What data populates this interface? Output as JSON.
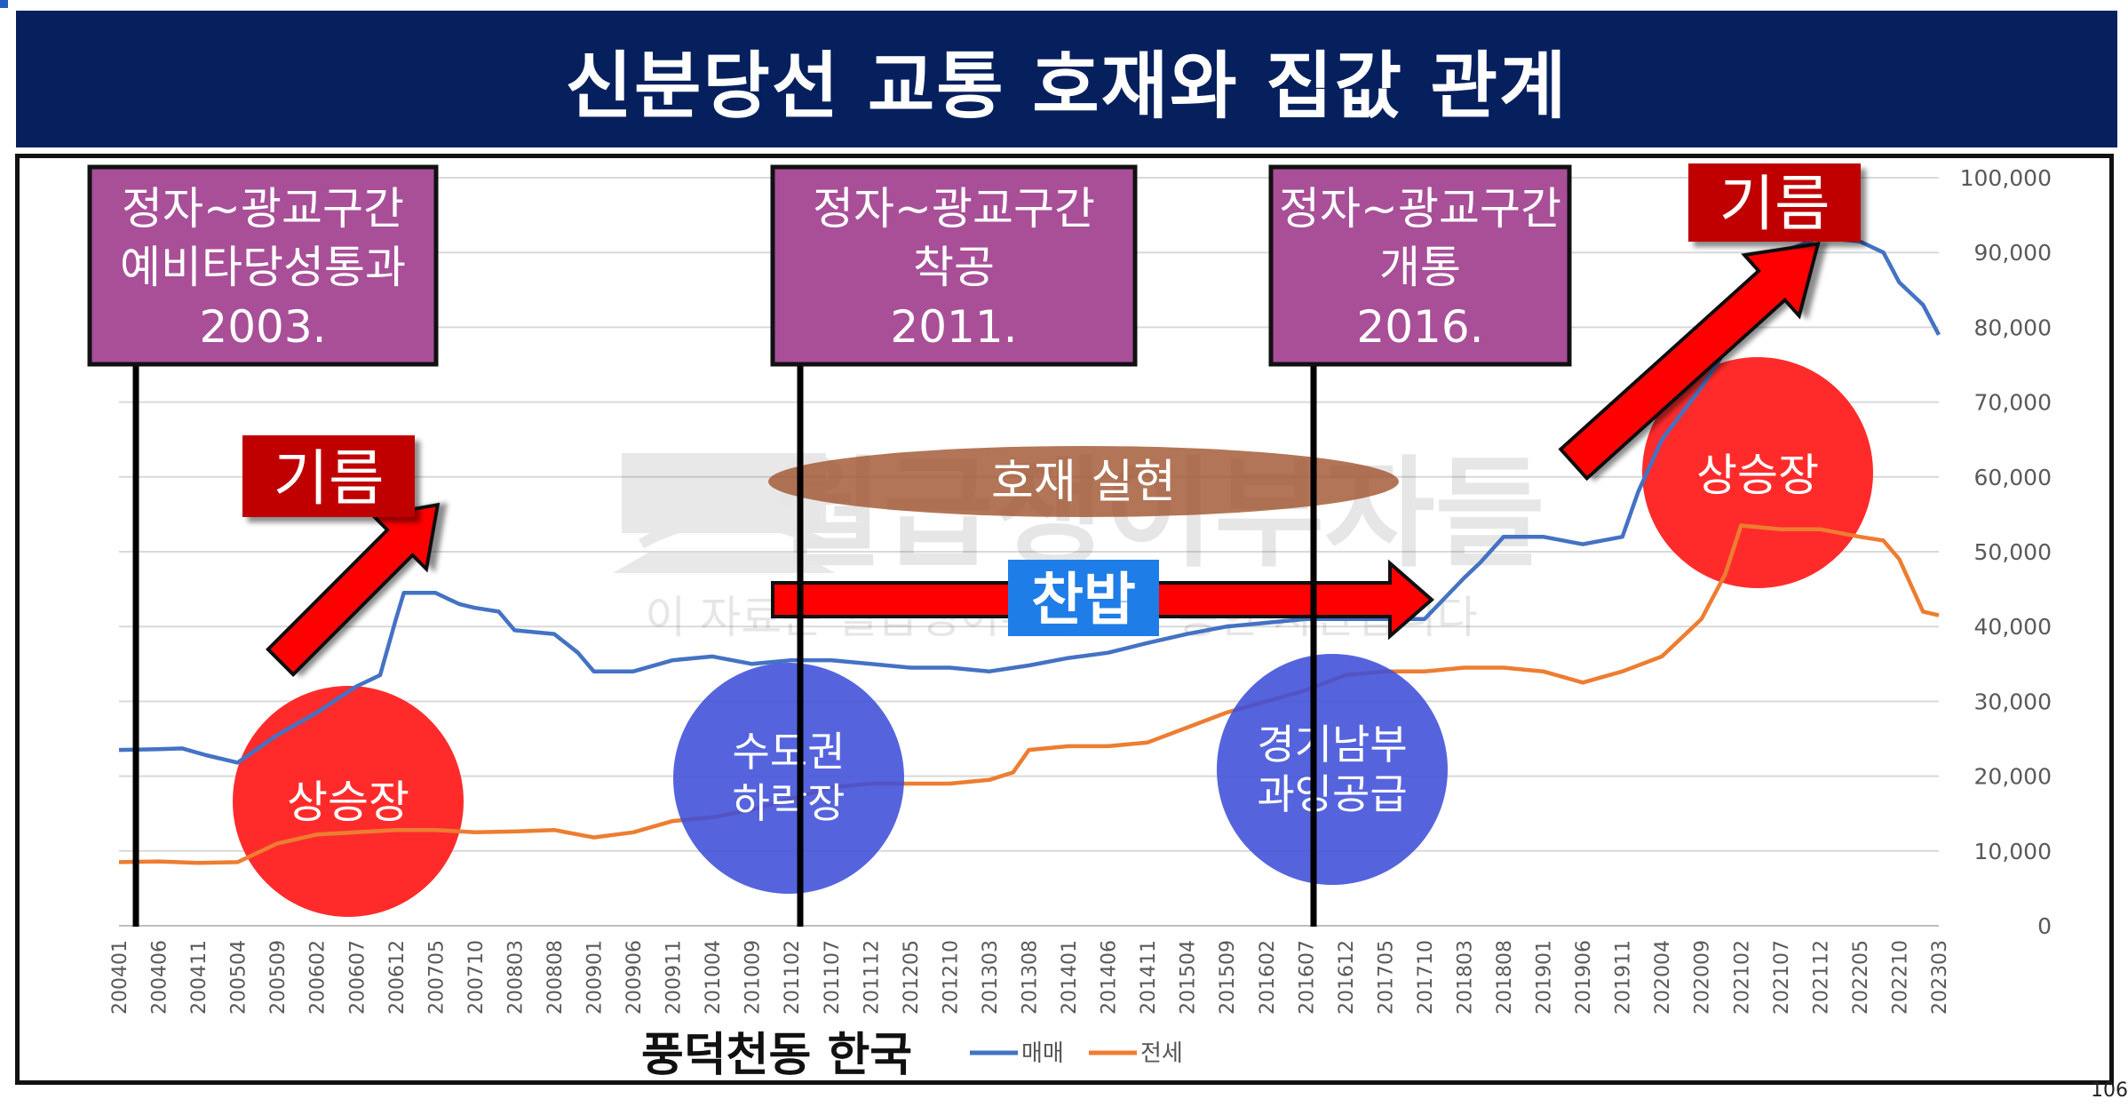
{
  "page": {
    "title": "신분당선 교통 호재와 집값 관계",
    "page_number": "106"
  },
  "watermark": {
    "line1": "월급쟁이부자들",
    "line2": "이 자료는 월급쟁이부자들을 통한 자산입니다"
  },
  "annotations": {
    "events": [
      {
        "line1": "정자~광교구간",
        "line2": "예비타당성통과",
        "line3": "2003."
      },
      {
        "line1": "정자~광교구간",
        "line2": "착공",
        "line3": "2011."
      },
      {
        "line1": "정자~광교구간",
        "line2": "개통",
        "line3": "2016."
      }
    ],
    "momentum_left": "기름",
    "momentum_right": "기름",
    "realization": "호재 실현",
    "cold_rice": "찬밥",
    "circles": [
      {
        "line1": "상승장",
        "line2": "",
        "color": "#ff2b2b"
      },
      {
        "line1": "수도권",
        "line2": "하락장",
        "color": "#3e4fd8"
      },
      {
        "line1": "경기남부",
        "line2": "과잉공급",
        "color": "#3e4fd8"
      },
      {
        "line1": "상승장",
        "line2": "",
        "color": "#ff2b2b"
      }
    ],
    "location": "풍덕천동 한국"
  },
  "chart_data": {
    "type": "line",
    "title": "신분당선 교통 호재와 집값 관계",
    "xlabel": "",
    "ylabel": "",
    "ylim": [
      0,
      100000
    ],
    "yticks": [
      "0",
      "10,000",
      "20,000",
      "30,000",
      "40,000",
      "50,000",
      "60,000",
      "70,000",
      "80,000",
      "90,000",
      "100,000"
    ],
    "xtick_labels": [
      "200401",
      "200406",
      "200411",
      "200504",
      "200509",
      "200602",
      "200607",
      "200612",
      "200705",
      "200710",
      "200803",
      "200808",
      "200901",
      "200906",
      "200911",
      "201004",
      "201009",
      "201102",
      "201107",
      "201112",
      "201205",
      "201210",
      "201303",
      "201308",
      "201401",
      "201406",
      "201411",
      "201504",
      "201509",
      "201602",
      "201607",
      "201612",
      "201705",
      "201710",
      "201803",
      "201808",
      "201901",
      "201906",
      "201911",
      "202004",
      "202009",
      "202102",
      "202107",
      "202112",
      "202205",
      "202210",
      "202303"
    ],
    "grid": true,
    "legend_position": "bottom",
    "colors": {
      "sale": "#4472c4",
      "jeonse": "#ed7d31"
    },
    "series": [
      {
        "name": "매매",
        "points": [
          [
            "200401",
            23500
          ],
          [
            "200406",
            23600
          ],
          [
            "200409",
            23700
          ],
          [
            "200412",
            22800
          ],
          [
            "200504",
            21800
          ],
          [
            "200509",
            25500
          ],
          [
            "200602",
            28500
          ],
          [
            "200607",
            32000
          ],
          [
            "200610",
            33500
          ],
          [
            "200612",
            41000
          ],
          [
            "200701",
            44500
          ],
          [
            "200705",
            44500
          ],
          [
            "200708",
            43000
          ],
          [
            "200710",
            42500
          ],
          [
            "200801",
            42000
          ],
          [
            "200803",
            39500
          ],
          [
            "200808",
            39000
          ],
          [
            "200811",
            36500
          ],
          [
            "200901",
            34000
          ],
          [
            "200906",
            34000
          ],
          [
            "200911",
            35500
          ],
          [
            "201004",
            36000
          ],
          [
            "201009",
            35000
          ],
          [
            "201102",
            35500
          ],
          [
            "201107",
            35500
          ],
          [
            "201112",
            35000
          ],
          [
            "201205",
            34500
          ],
          [
            "201210",
            34500
          ],
          [
            "201303",
            34000
          ],
          [
            "201308",
            34800
          ],
          [
            "201401",
            35800
          ],
          [
            "201406",
            36500
          ],
          [
            "201411",
            37800
          ],
          [
            "201504",
            39000
          ],
          [
            "201509",
            40000
          ],
          [
            "201602",
            40500
          ],
          [
            "201607",
            41000
          ],
          [
            "201612",
            41000
          ],
          [
            "201705",
            41000
          ],
          [
            "201710",
            41000
          ],
          [
            "201803",
            46500
          ],
          [
            "201805",
            48500
          ],
          [
            "201808",
            52000
          ],
          [
            "201901",
            52000
          ],
          [
            "201906",
            51000
          ],
          [
            "201911",
            52000
          ],
          [
            "202001",
            58000
          ],
          [
            "202004",
            65000
          ],
          [
            "202009",
            72000
          ],
          [
            "202102",
            80000
          ],
          [
            "202104",
            87000
          ],
          [
            "202107",
            90000
          ],
          [
            "202112",
            92000
          ],
          [
            "202205",
            91500
          ],
          [
            "202208",
            90000
          ],
          [
            "202210",
            86000
          ],
          [
            "202301",
            83000
          ],
          [
            "202303",
            79000
          ]
        ]
      },
      {
        "name": "전세",
        "points": [
          [
            "200401",
            8500
          ],
          [
            "200406",
            8600
          ],
          [
            "200411",
            8400
          ],
          [
            "200504",
            8500
          ],
          [
            "200509",
            11000
          ],
          [
            "200602",
            12200
          ],
          [
            "200607",
            12500
          ],
          [
            "200612",
            12800
          ],
          [
            "200705",
            12800
          ],
          [
            "200710",
            12500
          ],
          [
            "200803",
            12600
          ],
          [
            "200808",
            12800
          ],
          [
            "200901",
            11800
          ],
          [
            "200906",
            12500
          ],
          [
            "200911",
            14000
          ],
          [
            "201004",
            14500
          ],
          [
            "201009",
            15500
          ],
          [
            "201102",
            17000
          ],
          [
            "201107",
            18500
          ],
          [
            "201112",
            19000
          ],
          [
            "201205",
            19000
          ],
          [
            "201210",
            19000
          ],
          [
            "201303",
            19500
          ],
          [
            "201306",
            20500
          ],
          [
            "201308",
            23500
          ],
          [
            "201401",
            24000
          ],
          [
            "201406",
            24000
          ],
          [
            "201411",
            24500
          ],
          [
            "201504",
            26500
          ],
          [
            "201509",
            28500
          ],
          [
            "201602",
            30000
          ],
          [
            "201607",
            31500
          ],
          [
            "201612",
            33500
          ],
          [
            "201705",
            34000
          ],
          [
            "201710",
            34000
          ],
          [
            "201803",
            34500
          ],
          [
            "201808",
            34500
          ],
          [
            "201901",
            34000
          ],
          [
            "201906",
            32500
          ],
          [
            "201911",
            34000
          ],
          [
            "202004",
            36000
          ],
          [
            "202009",
            41000
          ],
          [
            "202012",
            47000
          ],
          [
            "202102",
            53500
          ],
          [
            "202107",
            53000
          ],
          [
            "202112",
            53000
          ],
          [
            "202205",
            52000
          ],
          [
            "202208",
            51500
          ],
          [
            "202210",
            49000
          ],
          [
            "202301",
            42000
          ],
          [
            "202303",
            41500
          ]
        ]
      }
    ]
  }
}
